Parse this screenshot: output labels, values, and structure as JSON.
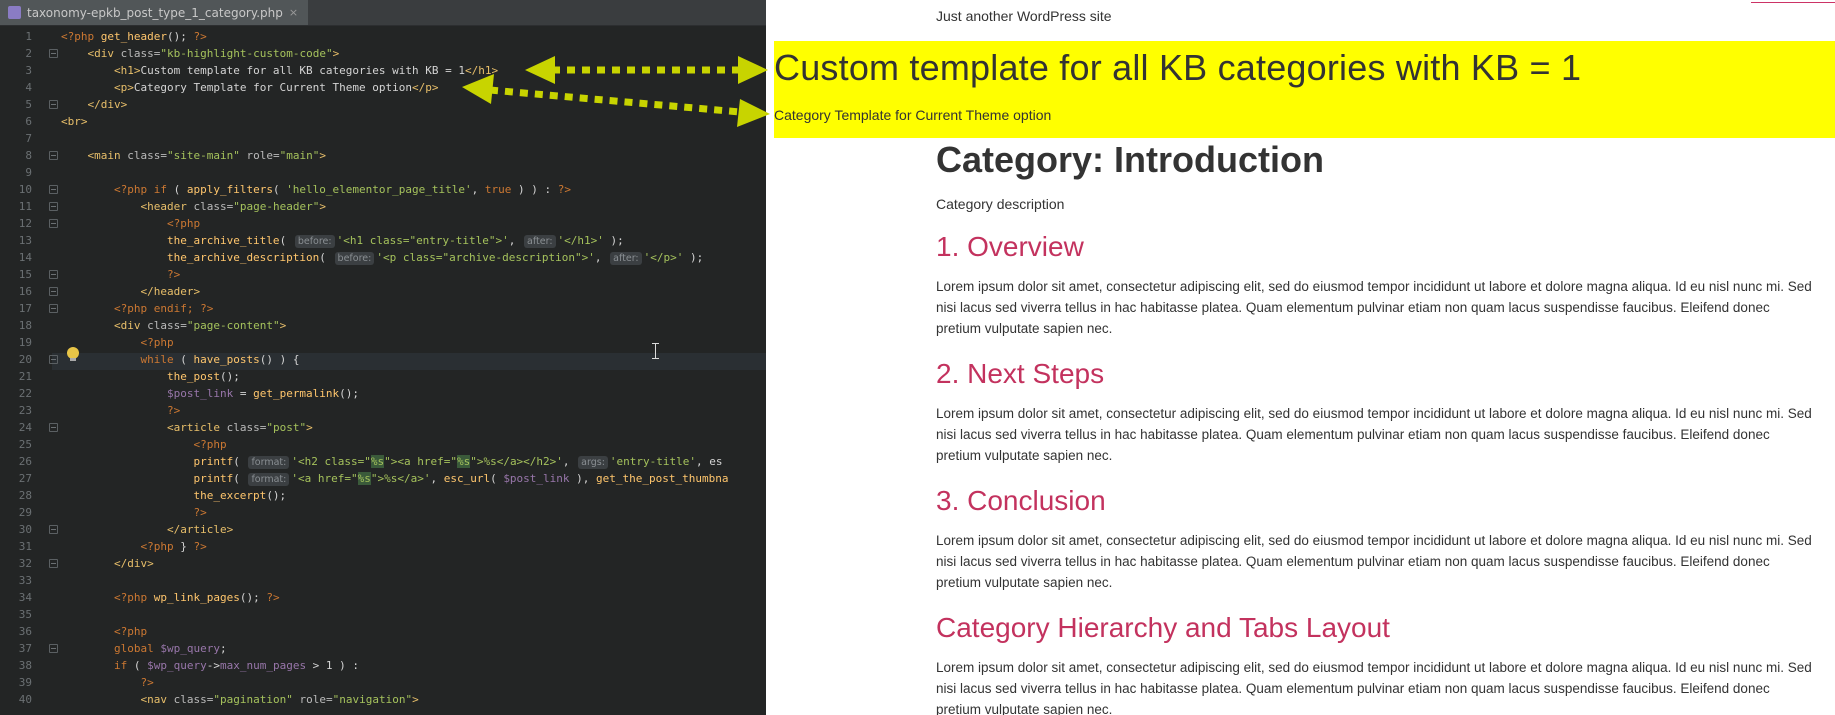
{
  "editor": {
    "tab_title": "taxonomy-epkb_post_type_1_category.php",
    "tab_close": "×",
    "line_numbers": [
      "1",
      "2",
      "3",
      "4",
      "5",
      "6",
      "7",
      "8",
      "9",
      "10",
      "11",
      "12",
      "13",
      "14",
      "15",
      "16",
      "17",
      "18",
      "19",
      "20",
      "21",
      "22",
      "23",
      "24",
      "25",
      "26",
      "27",
      "28",
      "29",
      "30",
      "31",
      "32",
      "33",
      "34",
      "35",
      "36",
      "37",
      "38",
      "39",
      "40"
    ],
    "hints": {
      "before": "before:",
      "after": "after:",
      "format": "format:",
      "args": "args:"
    }
  },
  "page": {
    "tagline": "Just another WordPress site",
    "banner_heading": "Custom template for all KB categories with KB = 1",
    "banner_text": "Category Template for Current Theme option",
    "category_title": "Category: Introduction",
    "category_description": "Category description",
    "posts": [
      {
        "title": "1. Overview",
        "excerpt": "Lorem ipsum dolor sit amet, consectetur adipiscing elit, sed do eiusmod tempor incididunt ut labore et dolore magna aliqua. Id eu nisl nunc mi. Sed nisi lacus sed viverra tellus in hac habitasse platea. Quam elementum pulvinar etiam non quam lacus suspendisse faucibus. Eleifend donec pretium vulputate sapien nec."
      },
      {
        "title": "2. Next Steps",
        "excerpt": "Lorem ipsum dolor sit amet, consectetur adipiscing elit, sed do eiusmod tempor incididunt ut labore et dolore magna aliqua. Id eu nisl nunc mi. Sed nisi lacus sed viverra tellus in hac habitasse platea. Quam elementum pulvinar etiam non quam lacus suspendisse faucibus. Eleifend donec pretium vulputate sapien nec."
      },
      {
        "title": "3. Conclusion",
        "excerpt": "Lorem ipsum dolor sit amet, consectetur adipiscing elit, sed do eiusmod tempor incididunt ut labore et dolore magna aliqua. Id eu nisl nunc mi. Sed nisi lacus sed viverra tellus in hac habitasse platea. Quam elementum pulvinar etiam non quam lacus suspendisse faucibus. Eleifend donec pretium vulputate sapien nec."
      },
      {
        "title": "Category Hierarchy and Tabs Layout",
        "excerpt": "Lorem ipsum dolor sit amet, consectetur adipiscing elit, sed do eiusmod tempor incididunt ut labore et dolore magna aliqua. Id eu nisl nunc mi. Sed nisi lacus sed viverra tellus in hac habitasse platea. Quam elementum pulvinar etiam non quam lacus suspendisse faucibus. Eleifend donec pretium vulputate sapien nec."
      }
    ]
  },
  "colors": {
    "banner_bg": "#ffff00",
    "arrow": "#c8d400",
    "post_title": "#c3325e"
  }
}
